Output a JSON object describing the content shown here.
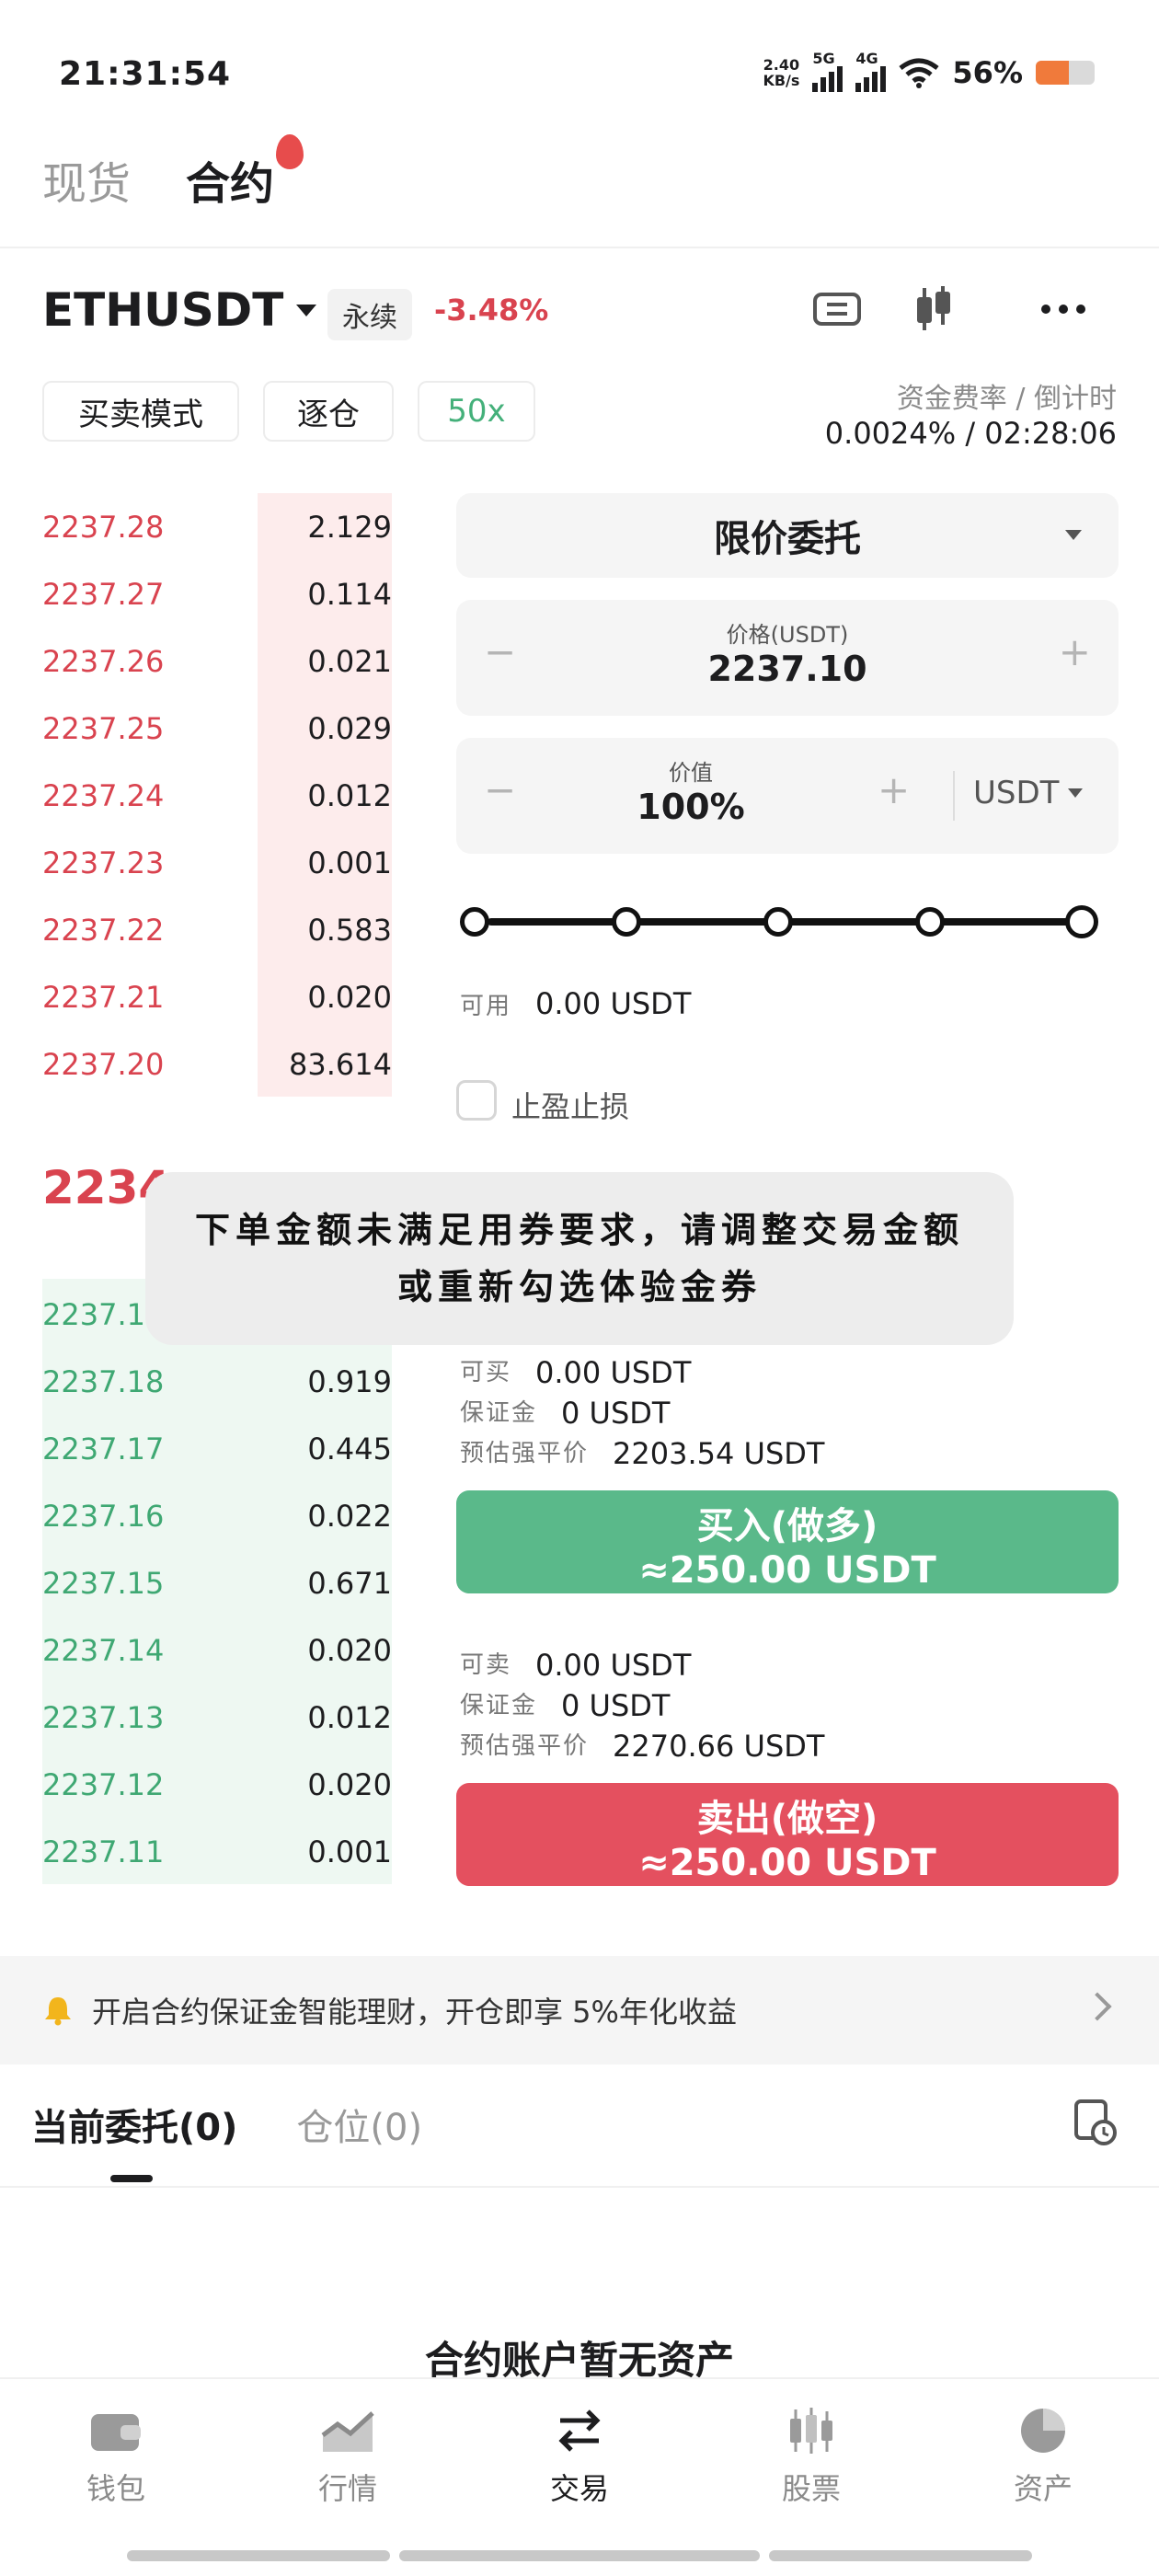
{
  "status_bar": {
    "time": "21:31:54",
    "speed_value": "2.40",
    "speed_unit": "KB/s",
    "net1": "5G",
    "net2": "4G",
    "battery": "56%"
  },
  "top_tabs": [
    "现货",
    "合约"
  ],
  "symbol": {
    "name": "ETHUSDT",
    "type": "永续",
    "change": "-3.48%"
  },
  "modes": {
    "trade_mode": "买卖模式",
    "margin_mode": "逐仓",
    "leverage": "50x"
  },
  "funding": {
    "label": "资金费率 / 倒计时",
    "value": "0.0024% / 02:28:06"
  },
  "orderbook": {
    "asks": [
      {
        "price": "2237.28",
        "qty": "2.129"
      },
      {
        "price": "2237.27",
        "qty": "0.114"
      },
      {
        "price": "2237.26",
        "qty": "0.021"
      },
      {
        "price": "2237.25",
        "qty": "0.029"
      },
      {
        "price": "2237.24",
        "qty": "0.012"
      },
      {
        "price": "2237.23",
        "qty": "0.001"
      },
      {
        "price": "2237.22",
        "qty": "0.583"
      },
      {
        "price": "2237.21",
        "qty": "0.020"
      },
      {
        "price": "2237.20",
        "qty": "83.614"
      }
    ],
    "last_price": "2234",
    "bids": [
      {
        "price": "2237.1",
        "qty": ""
      },
      {
        "price": "2237.18",
        "qty": "0.919"
      },
      {
        "price": "2237.17",
        "qty": "0.445"
      },
      {
        "price": "2237.16",
        "qty": "0.022"
      },
      {
        "price": "2237.15",
        "qty": "0.671"
      },
      {
        "price": "2237.14",
        "qty": "0.020"
      },
      {
        "price": "2237.13",
        "qty": "0.012"
      },
      {
        "price": "2237.12",
        "qty": "0.020"
      },
      {
        "price": "2237.11",
        "qty": "0.001"
      }
    ]
  },
  "order_form": {
    "order_type": "限价委托",
    "price_label": "价格(USDT)",
    "price_value": "2237.10",
    "value_label": "价值",
    "value_value": "100%",
    "unit": "USDT",
    "slider_percent": 100,
    "available_label": "可用",
    "available_value": "0.00 USDT",
    "tp_sl_label": "止盈止损"
  },
  "buy": {
    "can_label": "可买",
    "can_value": "0.00 USDT",
    "margin_label": "保证金",
    "margin_value": "0 USDT",
    "liq_label": "预估强平价",
    "liq_value": "2203.54 USDT",
    "button_line1": "买入(做多)",
    "button_line2": "≈250.00 USDT"
  },
  "sell": {
    "can_label": "可卖",
    "can_value": "0.00 USDT",
    "margin_label": "保证金",
    "margin_value": "0 USDT",
    "liq_label": "预估强平价",
    "liq_value": "2270.66 USDT",
    "button_line1": "卖出(做空)",
    "button_line2": "≈250.00 USDT"
  },
  "toast": "下单金额未满足用券要求，请调整交易金额或重新勾选体验金券",
  "banner": "开启合约保证金智能理财，开仓即享 5%年化收益",
  "bottom_tabs": {
    "orders": "当前委托(0)",
    "positions": "仓位(0)"
  },
  "empty_message": "合约账户暂无资产",
  "nav": [
    "钱包",
    "行情",
    "交易",
    "股票",
    "资产"
  ],
  "colors": {
    "ask": "#d9434f",
    "bid": "#3fa873",
    "buy_button": "#5ab98a",
    "sell_button": "#e4505f"
  }
}
